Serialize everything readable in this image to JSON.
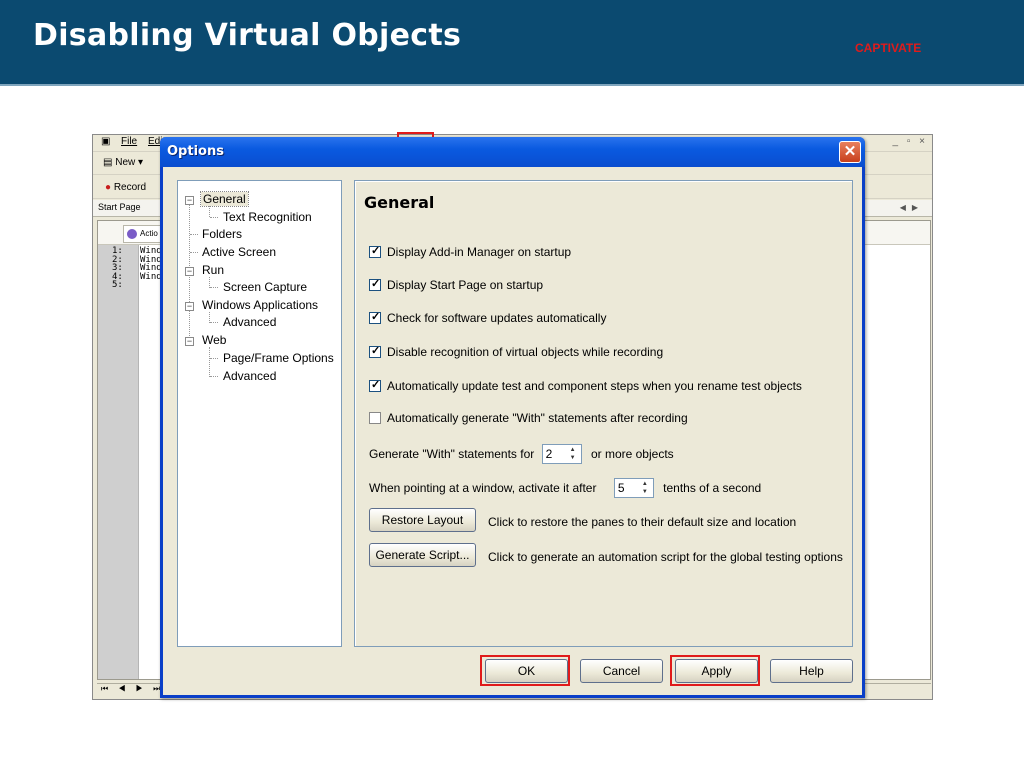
{
  "slide": {
    "title": "Disabling Virtual Objects",
    "tag": "CAPTIVATE",
    "tag_color": "#e01b1b",
    "header_color": "#0b4a70"
  },
  "app": {
    "menu": [
      "File",
      "Edit"
    ],
    "toolbar": {
      "new_label": "New",
      "record_label": "Record"
    },
    "tab": "Start Page",
    "action_tab": "Actio",
    "line_numbers": [
      "1:",
      "2:",
      "3:",
      "4:",
      "5:"
    ],
    "line_text": [
      "Wind",
      "Wind",
      "Wind",
      "Wind"
    ],
    "window_controls": "_ ▫ ×",
    "nav": "⏮ ◀ ▶ ⏭"
  },
  "dialog": {
    "title": "Options",
    "tree": [
      {
        "label": "General",
        "level": 0,
        "expander": "−",
        "selected": true
      },
      {
        "label": "Text Recognition",
        "level": 1
      },
      {
        "label": "Folders",
        "level": 0
      },
      {
        "label": "Active Screen",
        "level": 0
      },
      {
        "label": "Run",
        "level": 0,
        "expander": "−"
      },
      {
        "label": "Screen Capture",
        "level": 1
      },
      {
        "label": "Windows Applications",
        "level": 0,
        "expander": "−"
      },
      {
        "label": "Advanced",
        "level": 1
      },
      {
        "label": "Web",
        "level": 0,
        "expander": "−"
      },
      {
        "label": "Page/Frame Options",
        "level": 1
      },
      {
        "label": "Advanced",
        "level": 1
      }
    ],
    "panel": {
      "heading": "General",
      "options": [
        {
          "label": "Display Add-in Manager on startup",
          "checked": true
        },
        {
          "label": "Display Start Page on startup",
          "checked": true
        },
        {
          "label": "Check for software updates automatically",
          "checked": true
        },
        {
          "label": "Disable recognition of virtual objects while recording",
          "checked": true
        },
        {
          "label": "Automatically update test and component steps when you rename test objects",
          "checked": true
        },
        {
          "label": "Automatically generate \"With\" statements after recording",
          "checked": false
        }
      ],
      "with_statements": {
        "prefix": "Generate \"With\" statements for",
        "value": "2",
        "suffix": "or more objects"
      },
      "activate_window": {
        "prefix": "When pointing at a window, activate it after",
        "value": "5",
        "suffix": "tenths of a second"
      },
      "restore_layout": {
        "label": "Restore Layout",
        "description": "Click to restore the panes to their default size and location"
      },
      "generate_script": {
        "label": "Generate Script...",
        "description": "Click to generate an automation script for the global testing options"
      }
    },
    "buttons": {
      "ok": "OK",
      "cancel": "Cancel",
      "apply": "Apply",
      "help": "Help"
    }
  }
}
